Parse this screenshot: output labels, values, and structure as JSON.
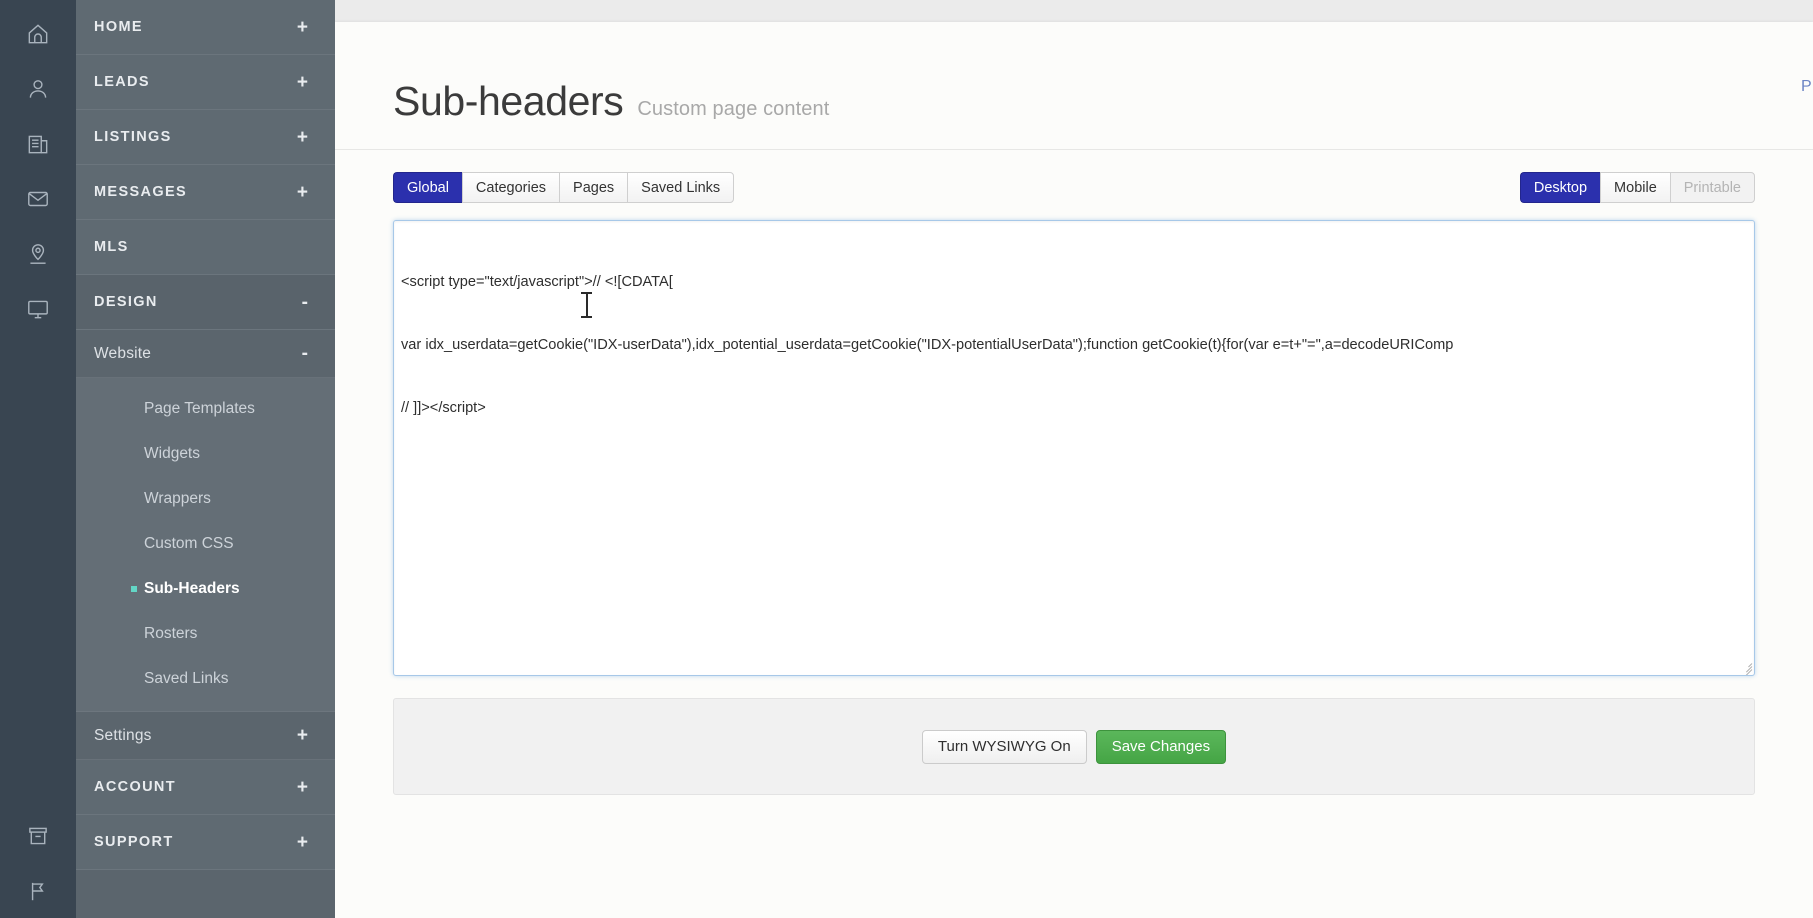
{
  "rail": {
    "icons": [
      {
        "name": "home-icon"
      },
      {
        "name": "leads-person-icon"
      },
      {
        "name": "listings-building-icon"
      },
      {
        "name": "messages-envelope-icon"
      },
      {
        "name": "mls-location-pin-icon"
      },
      {
        "name": "design-monitor-icon"
      }
    ],
    "bottom_icons": [
      {
        "name": "account-archive-icon"
      },
      {
        "name": "support-flag-icon"
      }
    ]
  },
  "sidebar": {
    "sections": [
      {
        "label": "HOME",
        "sign": "+"
      },
      {
        "label": "LEADS",
        "sign": "+"
      },
      {
        "label": "LISTINGS",
        "sign": "+"
      },
      {
        "label": "MESSAGES",
        "sign": "+"
      },
      {
        "label": "MLS",
        "sign": ""
      },
      {
        "label": "DESIGN",
        "sign": "-"
      }
    ],
    "website": {
      "label": "Website",
      "sign": "-"
    },
    "website_items": [
      {
        "label": "Page Templates",
        "current": false
      },
      {
        "label": "Widgets",
        "current": false
      },
      {
        "label": "Wrappers",
        "current": false
      },
      {
        "label": "Custom CSS",
        "current": false
      },
      {
        "label": "Sub-Headers",
        "current": true
      },
      {
        "label": "Rosters",
        "current": false
      },
      {
        "label": "Saved Links",
        "current": false
      }
    ],
    "settings": {
      "label": "Settings",
      "sign": "+"
    },
    "bottom_sections": [
      {
        "label": "ACCOUNT",
        "sign": "+"
      },
      {
        "label": "SUPPORT",
        "sign": "+"
      }
    ],
    "active_bullet_color": "#63d6c6"
  },
  "page": {
    "title": "Sub-headers",
    "subtitle": "Custom page content",
    "top_right_link": "P"
  },
  "toolbar": {
    "scope_tabs": [
      {
        "label": "Global",
        "active": true,
        "disabled": false
      },
      {
        "label": "Categories",
        "active": false,
        "disabled": false
      },
      {
        "label": "Pages",
        "active": false,
        "disabled": false
      },
      {
        "label": "Saved Links",
        "active": false,
        "disabled": false
      }
    ],
    "view_tabs": [
      {
        "label": "Desktop",
        "active": true,
        "disabled": false
      },
      {
        "label": "Mobile",
        "active": false,
        "disabled": false
      },
      {
        "label": "Printable",
        "active": false,
        "disabled": true
      }
    ],
    "active_color": "#2b30ad"
  },
  "editor": {
    "lines": [
      "<script type=\"text/javascript\">// <![CDATA[",
      "var idx_userdata=getCookie(\"IDX-userData\"),idx_potential_userdata=getCookie(\"IDX-potentialUserData\");function getCookie(t){for(var e=t+\"=\",a=decodeURIComp",
      "// ]]></script>"
    ]
  },
  "footer": {
    "wysiwyg_label": "Turn WYSIWYG On",
    "save_label": "Save Changes",
    "save_color": "#45a545"
  }
}
